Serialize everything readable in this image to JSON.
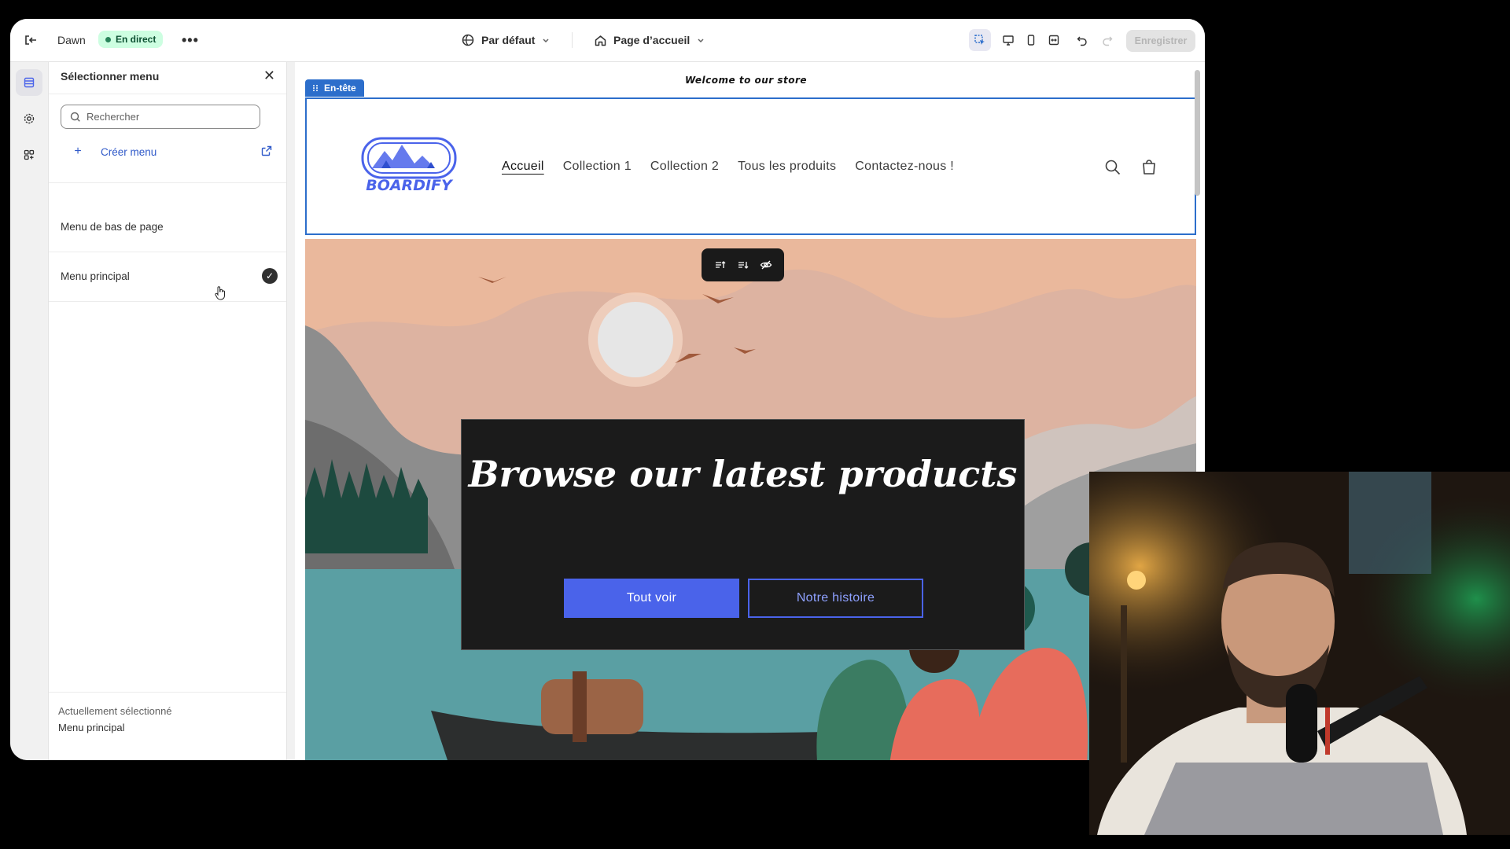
{
  "topbar": {
    "theme_name": "Dawn",
    "live_badge": "En direct",
    "more_label": "•••",
    "preset_label": "Par défaut",
    "page_label": "Page d’accueil",
    "save_label": "Enregistrer"
  },
  "panel": {
    "title": "Sélectionner menu",
    "close": "✕",
    "search_placeholder": "Rechercher",
    "create_label": "Créer menu",
    "items": [
      {
        "label": "Menu de bas de page",
        "selected": false
      },
      {
        "label": "Menu principal",
        "selected": true
      }
    ],
    "footer_label": "Actuellement sélectionné",
    "footer_value": "Menu principal"
  },
  "preview": {
    "announcement": "Welcome to our store",
    "section_label": "En-tête",
    "logo_text": "BOARDIFY",
    "nav": [
      "Accueil",
      "Collection 1",
      "Collection 2",
      "Tous les produits",
      "Contactez-nous !"
    ],
    "hero_title": "Browse our latest products",
    "hero_primary": "Tout voir",
    "hero_secondary": "Notre histoire"
  },
  "colors": {
    "accent": "#2c6ecb",
    "hero_button": "#4a63ea",
    "live_bg": "#cdfee1"
  }
}
